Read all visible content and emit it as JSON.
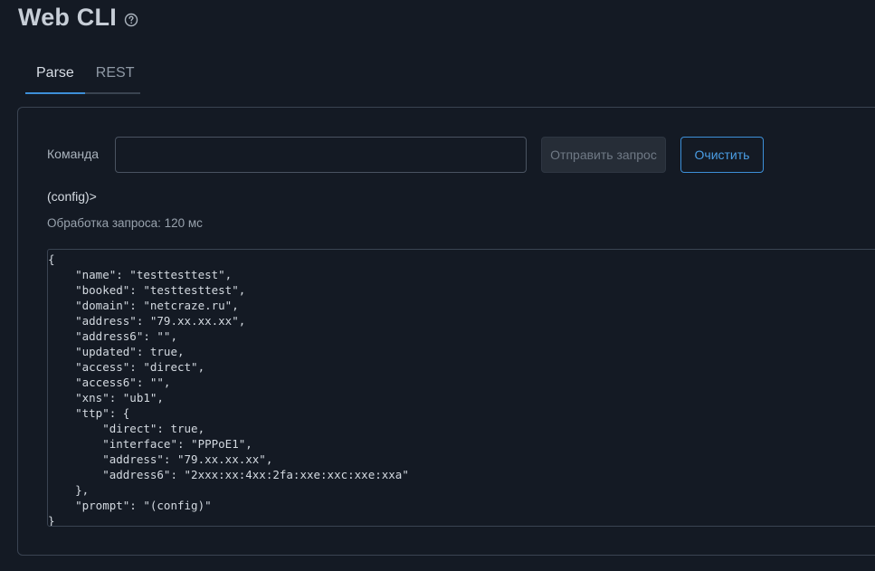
{
  "header": {
    "title": "Web CLI",
    "help_icon": "question-circle-icon"
  },
  "tabs": [
    {
      "label": "Parse",
      "active": true
    },
    {
      "label": "REST",
      "active": false
    }
  ],
  "form": {
    "command_label": "Команда",
    "command_value": "",
    "command_placeholder": "",
    "send_label": "Отправить запрос",
    "clear_label": "Очистить"
  },
  "result": {
    "prompt": "(config)>",
    "timing": "Обработка запроса: 120 мс",
    "output": "{\n    \"name\": \"testtesttest\",\n    \"booked\": \"testtesttest\",\n    \"domain\": \"netcraze.ru\",\n    \"address\": \"79.xx.xx.xx\",\n    \"address6\": \"\",\n    \"updated\": true,\n    \"access\": \"direct\",\n    \"access6\": \"\",\n    \"xns\": \"ub1\",\n    \"ttp\": {\n        \"direct\": true,\n        \"interface\": \"PPPoE1\",\n        \"address\": \"79.xx.xx.xx\",\n        \"address6\": \"2xxx:xx:4xx:2fa:xxe:xxc:xxe:xxa\"\n    },\n    \"prompt\": \"(config)\"\n}"
  },
  "colors": {
    "background": "#141a24",
    "accent": "#3d8fd8",
    "border": "#3a4452"
  }
}
